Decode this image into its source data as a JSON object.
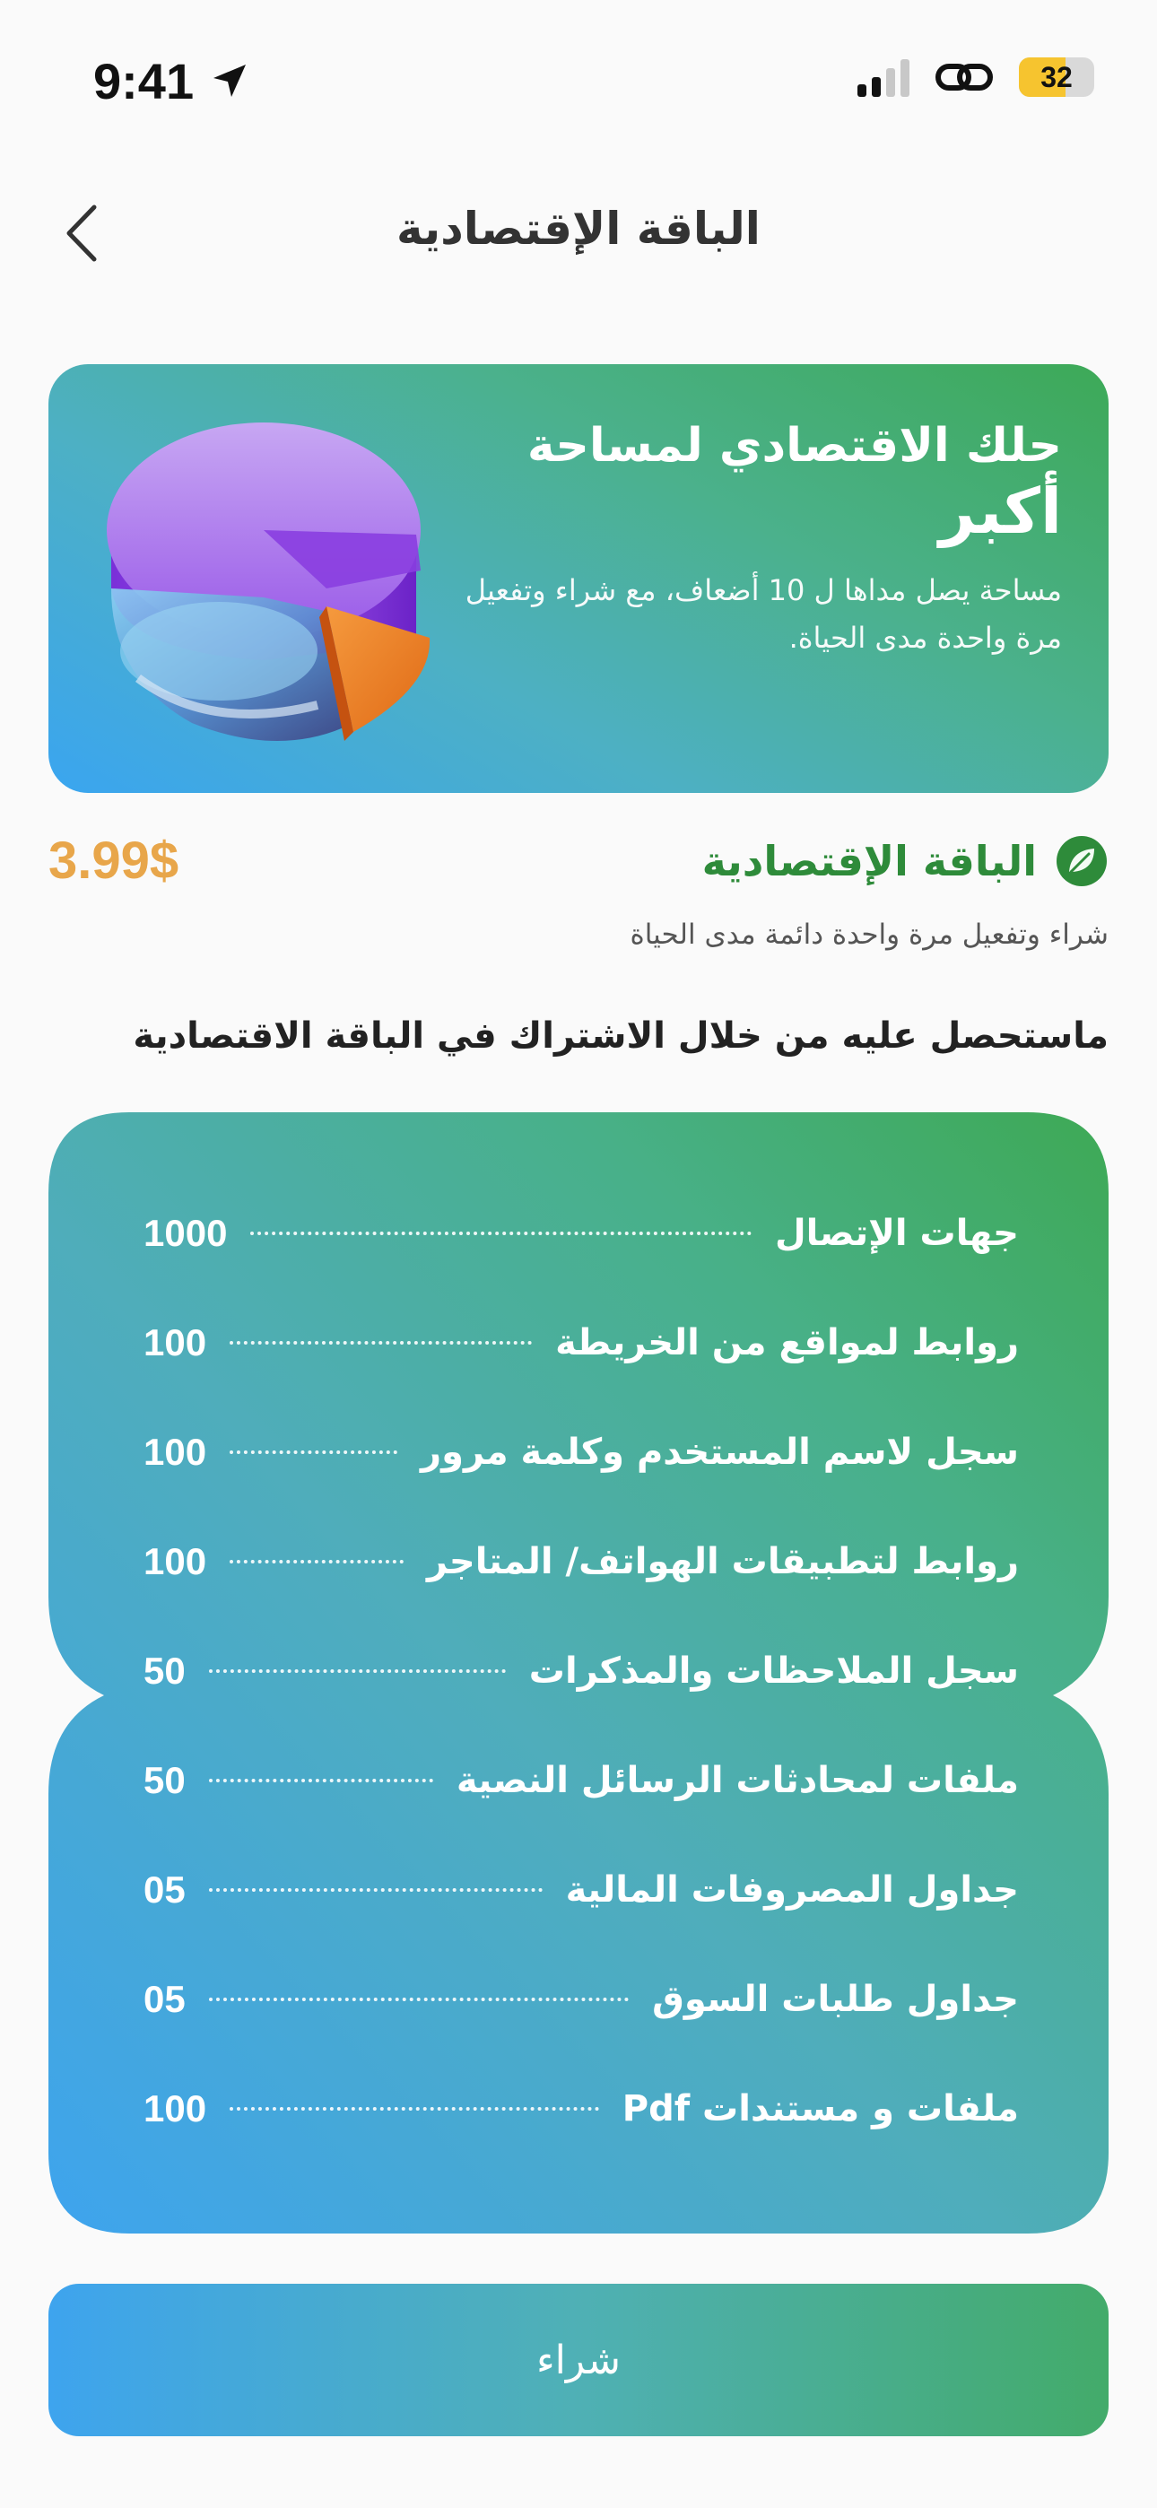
{
  "status": {
    "time": "9:41",
    "battery": "32"
  },
  "nav": {
    "title": "الباقة الإقتصادية"
  },
  "hero": {
    "title_line1": "حلك الاقتصادي لمساحة",
    "title_line2": "أكبر",
    "subtitle": "مساحة يصل مداها ل 10 أضعاف، مع شراء وتفعيل مرة واحدة مدى الحياة."
  },
  "package": {
    "name": "الباقة الإقتصادية",
    "price": "3.99$",
    "description": "شراء وتفعيل مرة واحدة دائمة مدى الحياة",
    "brand_color": "#2e8b3a",
    "price_color": "#e8a64a"
  },
  "section": {
    "title": "ماستحصل عليه من خلال الاشتراك في الباقة الاقتصادية"
  },
  "features": [
    {
      "label": "جهات الإتصال",
      "value": "1000"
    },
    {
      "label": "روابط لمواقع من الخريطة",
      "value": "100"
    },
    {
      "label": "سجل لاسم المستخدم وكلمة مرور",
      "value": "100"
    },
    {
      "label": "روابط لتطبيقات الهواتف/ المتاجر",
      "value": "100"
    },
    {
      "label": "سجل الملاحظات والمذكرات",
      "value": "50"
    },
    {
      "label": "ملفات لمحادثات الرسائل النصية",
      "value": "50"
    },
    {
      "label": "جداول المصروفات المالية",
      "value": "05"
    },
    {
      "label": "جداول طلبات السوق",
      "value": "05"
    },
    {
      "label": "ملفات و مستندات Pdf",
      "value": "100"
    }
  ],
  "buy_button": {
    "label": "شراء"
  }
}
